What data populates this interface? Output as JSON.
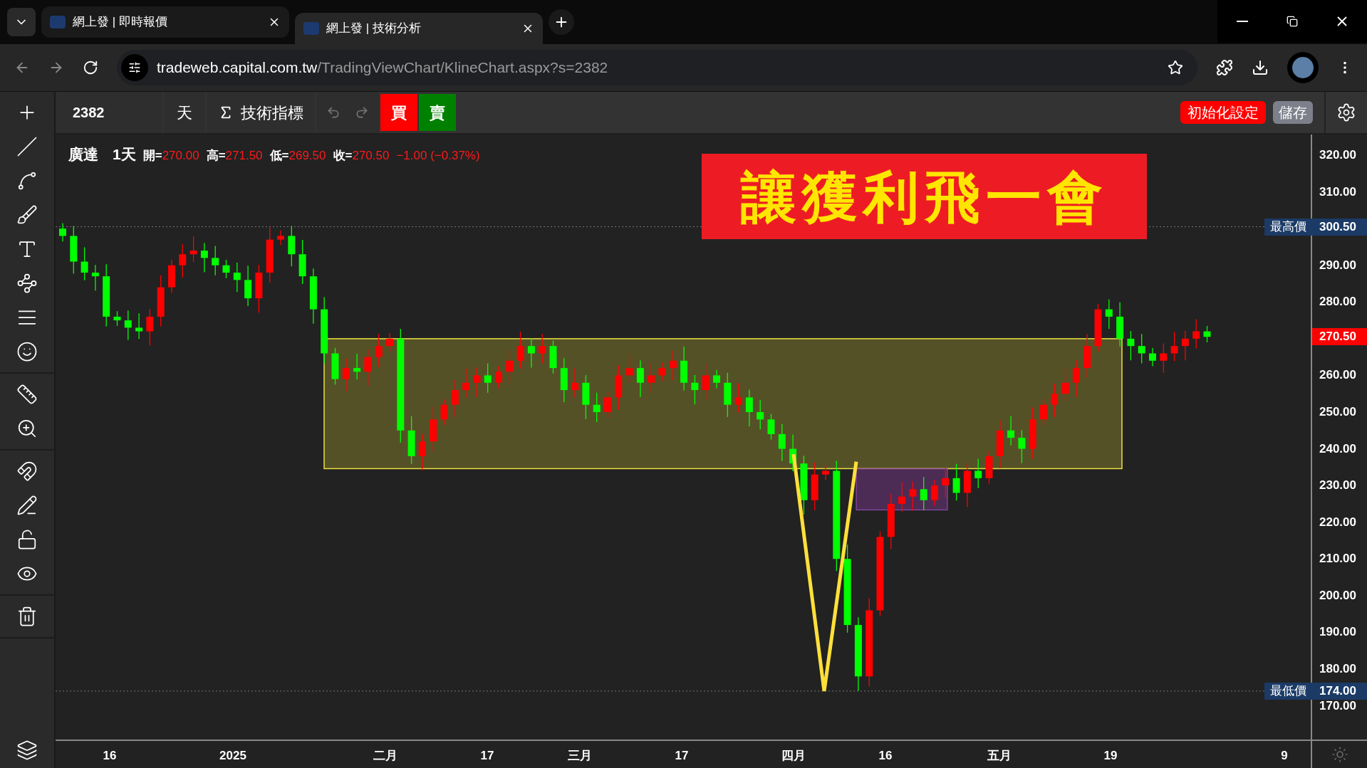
{
  "browser": {
    "tabs": [
      {
        "title": "網上發 | 即時報價",
        "selected": false
      },
      {
        "title": "網上發 | 技術分析",
        "selected": true
      }
    ],
    "url": {
      "host": "tradeweb.capital.com.tw",
      "path": "/TradingViewChart/KlineChart.aspx?s=2382"
    }
  },
  "toolbar": {
    "symbol": "2382",
    "interval": "天",
    "indicators": "技術指標",
    "buy": "買",
    "sell": "賣",
    "reset": "初始化設定",
    "save": "儲存"
  },
  "legend": {
    "name": "廣達",
    "interval": "1天",
    "fields": [
      {
        "label": "開=",
        "value": "270.00"
      },
      {
        "label": "高=",
        "value": "271.50"
      },
      {
        "label": "低=",
        "value": "269.50"
      },
      {
        "label": "收=",
        "value": "270.50"
      }
    ],
    "change": "−1.00 (−0.37%)"
  },
  "banner": "讓獲利飛一會",
  "price_axis": {
    "ticks": [
      "320.00",
      "310.00",
      "290.00",
      "280.00",
      "260.00",
      "250.00",
      "240.00",
      "230.00",
      "220.00",
      "210.00",
      "200.00",
      "190.00",
      "180.00",
      "170.00"
    ],
    "markers": [
      {
        "kind": "high",
        "label": "最高價",
        "value": "300.50"
      },
      {
        "kind": "low",
        "label": "最低價",
        "value": "174.00"
      }
    ],
    "last_price": "270.50"
  },
  "time_axis": [
    "16",
    "2025",
    "二月",
    "17",
    "三月",
    "17",
    "四月",
    "16",
    "五月",
    "19",
    "9"
  ]
}
